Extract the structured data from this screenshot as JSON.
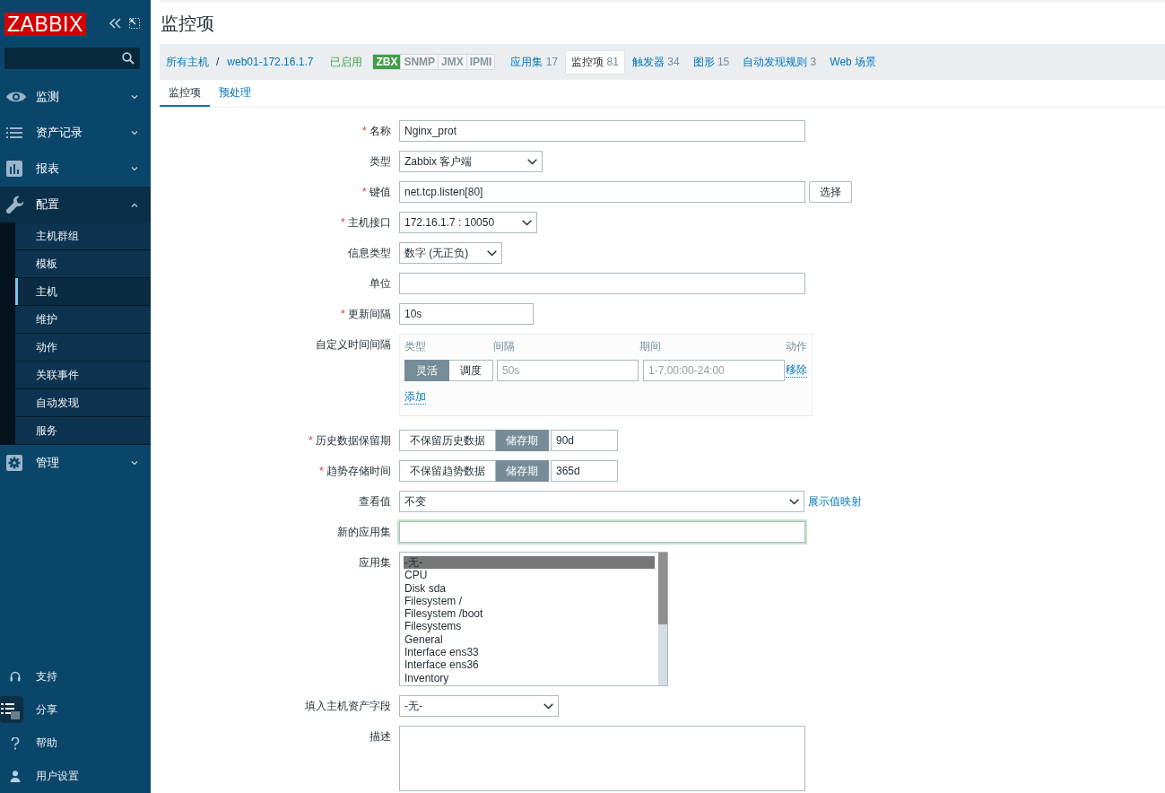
{
  "sidebar": {
    "logo": "ZABBIX",
    "menu": [
      {
        "label": "监测",
        "expanded": false
      },
      {
        "label": "资产记录",
        "expanded": false
      },
      {
        "label": "报表",
        "expanded": false
      },
      {
        "label": "配置",
        "expanded": true,
        "children": [
          {
            "label": "主机群组",
            "selected": false
          },
          {
            "label": "模板",
            "selected": false
          },
          {
            "label": "主机",
            "selected": true
          },
          {
            "label": "维护",
            "selected": false
          },
          {
            "label": "动作",
            "selected": false
          },
          {
            "label": "关联事件",
            "selected": false
          },
          {
            "label": "自动发现",
            "selected": false
          },
          {
            "label": "服务",
            "selected": false
          }
        ]
      },
      {
        "label": "管理",
        "expanded": false
      }
    ],
    "footer": [
      {
        "label": "支持"
      },
      {
        "label": "分享"
      },
      {
        "label": "帮助"
      },
      {
        "label": "用户设置"
      }
    ]
  },
  "header": {
    "title": "监控项"
  },
  "host_nav": {
    "breadcrumbs": [
      {
        "label": "所有主机"
      },
      {
        "label": "web01-172.16.1.7"
      }
    ],
    "separator": "/",
    "status": "已启用",
    "availability": [
      {
        "label": "ZBX",
        "on": true
      },
      {
        "label": "SNMP",
        "on": false
      },
      {
        "label": "JMX",
        "on": false
      },
      {
        "label": "IPMI",
        "on": false
      }
    ],
    "tabs": [
      {
        "label": "应用集",
        "count": "17",
        "selected": false
      },
      {
        "label": "监控项",
        "count": "81",
        "selected": true
      },
      {
        "label": "触发器",
        "count": "34",
        "selected": false
      },
      {
        "label": "图形",
        "count": "15",
        "selected": false
      },
      {
        "label": "自动发现规则",
        "count": "3",
        "selected": false
      },
      {
        "label": "Web 场景",
        "selected": false
      }
    ]
  },
  "sub_tabs": [
    {
      "label": "监控项",
      "selected": true
    },
    {
      "label": "预处理",
      "selected": false
    }
  ],
  "form": {
    "required_mark": "*",
    "fields": [
      {
        "kind": "input",
        "label": "名称",
        "required": true,
        "value": "Nginx_prot"
      },
      {
        "kind": "select",
        "label": "类型",
        "required": false,
        "value": "Zabbix 客户端"
      },
      {
        "kind": "input",
        "label": "键值",
        "required": true,
        "value": "net.tcp.listen[80]",
        "button": "选择"
      },
      {
        "kind": "select",
        "label": "主机接口",
        "required": true,
        "value": "172.16.1.7 : 10050"
      },
      {
        "kind": "select",
        "label": "信息类型",
        "required": false,
        "value": "数字 (无正负)"
      },
      {
        "kind": "input",
        "label": "单位",
        "required": false
      },
      {
        "kind": "input",
        "label": "更新间隔",
        "required": true,
        "value": "10s"
      },
      {
        "kind": "intervals",
        "label": "自定义时间间隔",
        "required": false,
        "columns": [
          "类型",
          "间隔",
          "期间",
          "动作"
        ],
        "rows": [
          {
            "types": [
              {
                "label": "灵活",
                "selected": true
              },
              {
                "label": "调度",
                "selected": false
              }
            ],
            "interval": {
              "placeholder": "50s"
            },
            "period": {
              "placeholder": "1-7,00:00-24:00"
            },
            "action": "移除"
          }
        ],
        "add_link": "添加"
      },
      {
        "kind": "storage",
        "label": "历史数据保留期",
        "required": true,
        "options": [
          {
            "label": "不保留历史数据",
            "selected": false
          },
          {
            "label": "储存期",
            "selected": true
          }
        ],
        "value": "90d"
      },
      {
        "kind": "storage",
        "label": "趋势存储时间",
        "required": true,
        "options": [
          {
            "label": "不保留趋势数据",
            "selected": false
          },
          {
            "label": "储存期",
            "selected": true
          }
        ],
        "value": "365d"
      },
      {
        "kind": "select",
        "label": "查看值",
        "required": false,
        "value": "不变",
        "link": "展示值映射"
      },
      {
        "kind": "input",
        "label": "新的应用集",
        "required": false,
        "focused": true
      },
      {
        "kind": "listbox",
        "label": "应用集",
        "required": false,
        "options": [
          {
            "label": "-无-",
            "selected": true
          },
          {
            "label": "CPU",
            "selected": false
          },
          {
            "label": "Disk sda",
            "selected": false
          },
          {
            "label": "Filesystem /",
            "selected": false
          },
          {
            "label": "Filesystem /boot",
            "selected": false
          },
          {
            "label": "Filesystems",
            "selected": false
          },
          {
            "label": "General",
            "selected": false
          },
          {
            "label": "Interface ens33",
            "selected": false
          },
          {
            "label": "Interface ens36",
            "selected": false
          },
          {
            "label": "Inventory",
            "selected": false
          }
        ]
      },
      {
        "kind": "select",
        "label": "填入主机资产字段",
        "required": false,
        "value": "-无-"
      },
      {
        "kind": "textarea",
        "label": "描述",
        "required": false
      }
    ]
  }
}
